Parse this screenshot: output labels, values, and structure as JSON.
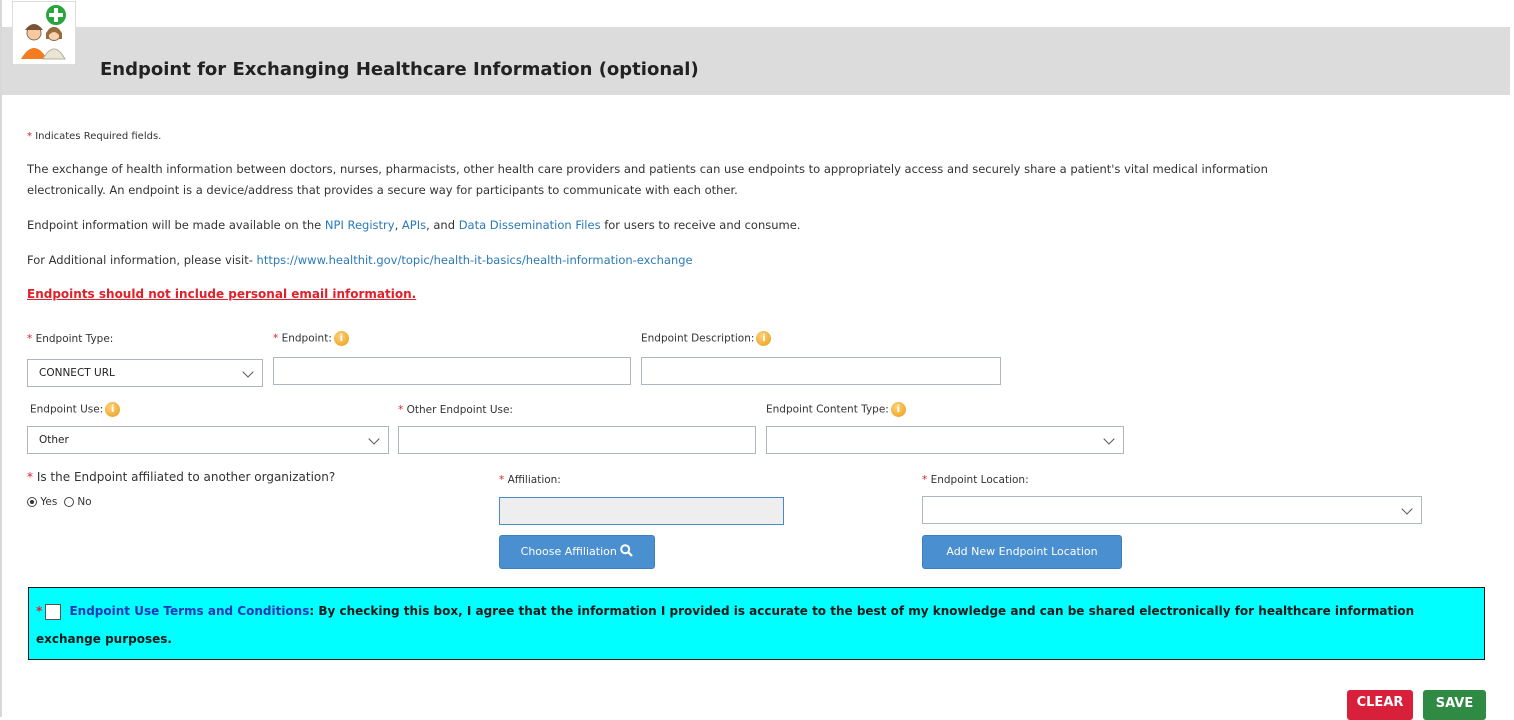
{
  "header": {
    "title": "Endpoint for Exchanging Healthcare Information (optional)"
  },
  "required_note": "Indicates Required fields.",
  "intro": {
    "p1_line1": "The exchange of health information between doctors, nurses, pharmacists, other health care providers and patients can use endpoints to appropriately access and securely share a patient's vital medical information",
    "p1_line2": "electronically.  An endpoint is a device/address that provides a secure way for participants to communicate with each other.",
    "p2_prefix": "Endpoint information will be made available on the ",
    "p2_link1": "NPI Registry",
    "p2_sep1": ", ",
    "p2_link2": "APIs",
    "p2_sep2": ", and ",
    "p2_link3": "Data Dissemination Files",
    "p2_suffix": " for users to receive and consume.",
    "p3_prefix": "For Additional information, please visit- ",
    "p3_link": "https://www.healthit.gov/topic/health-it-basics/health-information-exchange"
  },
  "warning": "Endpoints should not include personal email information.",
  "fields": {
    "endpoint_type": {
      "label": "Endpoint Type:",
      "value": "CONNECT URL"
    },
    "endpoint": {
      "label": "Endpoint:",
      "value": ""
    },
    "endpoint_description": {
      "label": "Endpoint Description:",
      "value": ""
    },
    "endpoint_use": {
      "label": "Endpoint Use:",
      "value": "Other"
    },
    "other_endpoint_use": {
      "label": "Other Endpoint Use:",
      "value": ""
    },
    "endpoint_content_type": {
      "label": "Endpoint Content Type:",
      "value": ""
    },
    "affiliated_question": "Is the Endpoint affiliated to another organization?",
    "radio_yes": "Yes",
    "radio_no": "No",
    "affiliation": {
      "label": "Affiliation:",
      "value": ""
    },
    "endpoint_location": {
      "label": "Endpoint Location:",
      "value": ""
    }
  },
  "buttons": {
    "choose_affiliation": "Choose Affiliation",
    "add_location": "Add New Endpoint Location",
    "clear": "CLEAR",
    "save": "SAVE"
  },
  "terms": {
    "link": "Endpoint Use Terms and Conditions",
    "text": ": By checking this box, I agree that the information I provided is accurate to the best of my knowledge and can be shared electronically for healthcare information exchange purposes."
  },
  "icons": {
    "info": "info-icon",
    "search": "magnifier-icon",
    "logo": "add-provider-logo"
  },
  "colors": {
    "required": "#e0202a",
    "link": "#2a7ab8",
    "terms_bg": "#00ffff",
    "clear_button": "#d8203a",
    "save_button": "#2f8b43",
    "primary_button": "#4a8fcf"
  }
}
